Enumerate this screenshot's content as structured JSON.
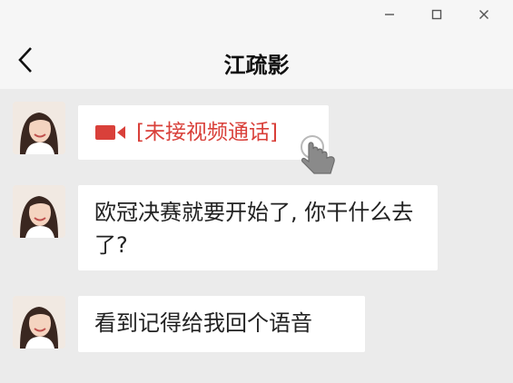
{
  "header": {
    "title": "江疏影"
  },
  "messages": [
    {
      "type": "missed-video-call",
      "text": "[未接视频通话]"
    },
    {
      "type": "text",
      "text": "欧冠决赛就要开始了, 你干什么去了?"
    },
    {
      "type": "text",
      "text": "看到记得给我回个语音"
    }
  ],
  "colors": {
    "missed_call": "#d9403a",
    "background": "#ebebeb",
    "bubble": "#ffffff"
  },
  "icons": [
    "minimize-icon",
    "maximize-icon",
    "close-icon",
    "back-arrow-icon",
    "video-camera-icon",
    "hand-pointer-icon"
  ]
}
